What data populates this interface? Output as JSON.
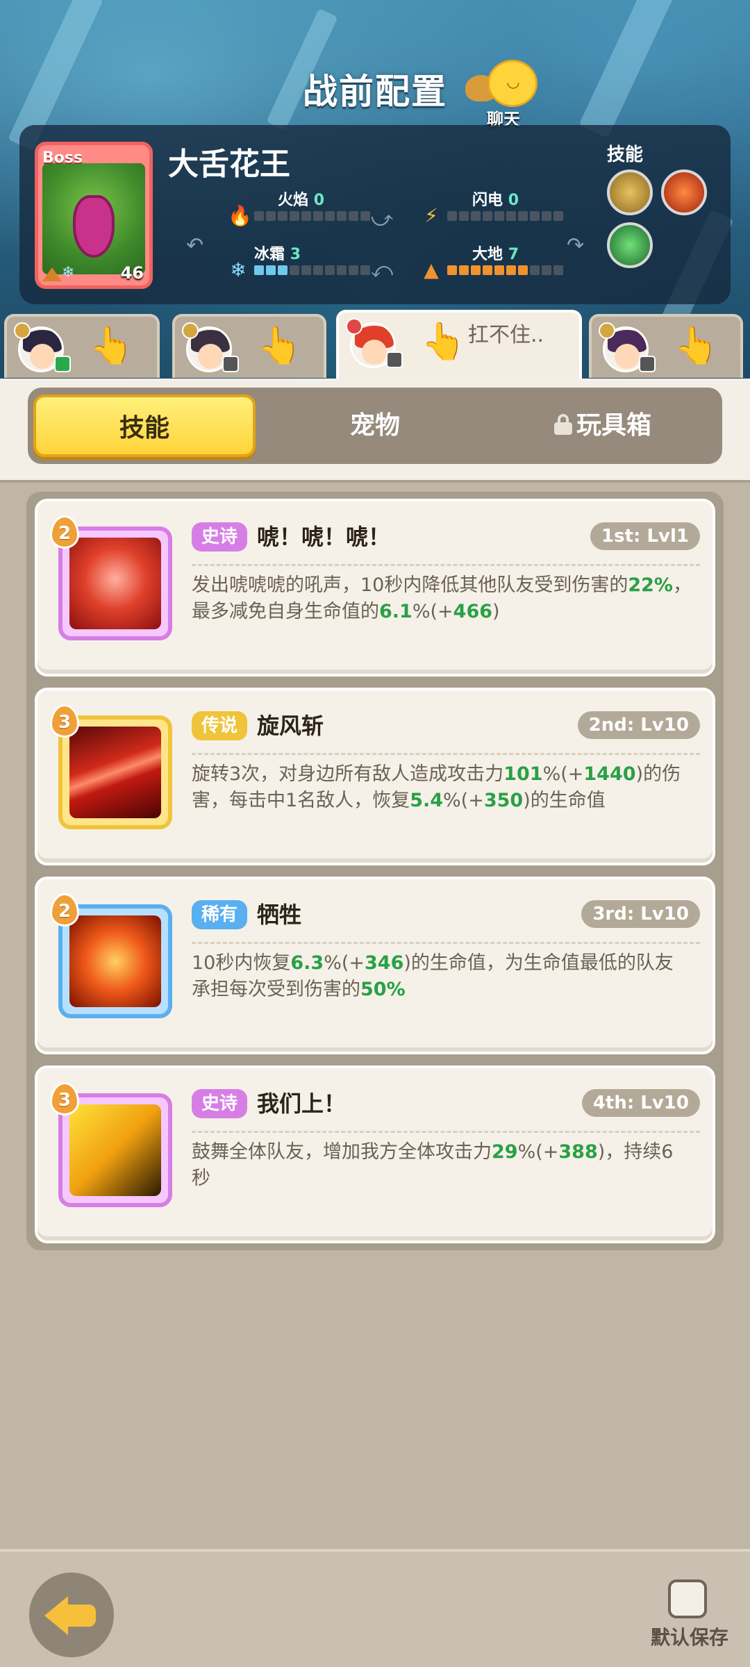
{
  "header": {
    "title": "战前配置",
    "chat_label": "聊天"
  },
  "boss": {
    "badge": "Boss",
    "name": "大舌花王",
    "level": "46",
    "elements": [
      {
        "name": "火焰",
        "value": "0",
        "icon": "fire-icon"
      },
      {
        "name": "闪电",
        "value": "0",
        "icon": "lightning-icon"
      },
      {
        "name": "冰霜",
        "value": "3",
        "icon": "frost-icon"
      },
      {
        "name": "大地",
        "value": "7",
        "icon": "earth-icon"
      }
    ],
    "skills_label": "技能"
  },
  "characters": [
    {
      "hint": ""
    },
    {
      "hint": ""
    },
    {
      "hint": "扛不住.."
    },
    {
      "hint": ""
    }
  ],
  "tabs": [
    "技能",
    "宠物",
    "玩具箱"
  ],
  "skills": [
    {
      "level": "2",
      "rarity": "史诗",
      "name": "唬！唬！唬！",
      "slot": "1st: Lvl1",
      "desc": [
        "发出唬唬唬的吼声，10秒内降低其他队友受到伤害的",
        "22%",
        "，最多减免自身生命值的",
        "6.1",
        "%(+",
        "466",
        ")"
      ]
    },
    {
      "level": "3",
      "rarity": "传说",
      "name": "旋风斩",
      "slot": "2nd: Lv10",
      "desc": [
        "旋转3次，对身边所有敌人造成攻击力",
        "101",
        "%(+",
        "1440",
        ")的伤害，每击中1名敌人，恢复",
        "5.4",
        "%(+",
        "350",
        ")的生命值"
      ]
    },
    {
      "level": "2",
      "rarity": "稀有",
      "name": "牺牲",
      "slot": "3rd: Lv10",
      "desc": [
        "10秒内恢复",
        "6.3",
        "%(+",
        "346",
        ")的生命值，为生命值最低的队友承担每次受到伤害的",
        "50%"
      ]
    },
    {
      "level": "3",
      "rarity": "史诗",
      "name": "我们上！",
      "slot": "4th: Lv10",
      "desc": [
        "鼓舞全体队友，增加我方全体攻击力",
        "29",
        "%(+",
        "388",
        ")，持续6秒"
      ]
    }
  ],
  "footer": {
    "default_save_label": "默认保存"
  },
  "colors": {
    "epic": "#d77ee6",
    "legend": "#f0c43a",
    "rare": "#5aaff0",
    "highlight_green": "#2aa046",
    "active_tab": "#ffd43a"
  }
}
